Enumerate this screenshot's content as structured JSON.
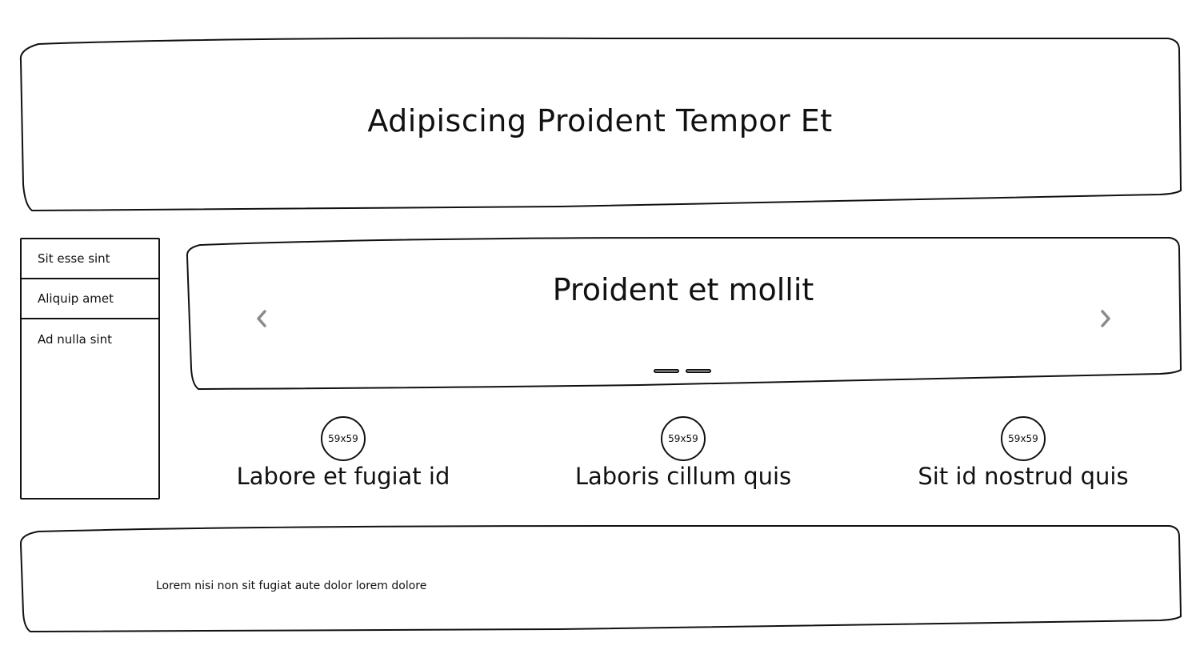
{
  "header": {
    "title": "Adipiscing Proident Tempor Et"
  },
  "sidebar": {
    "items": [
      {
        "label": "Sit esse sint"
      },
      {
        "label": "Aliquip amet"
      },
      {
        "label": "Ad nulla sint"
      }
    ]
  },
  "carousel": {
    "title": "Proident et mollit",
    "prev_icon": "chevron-left-icon",
    "next_icon": "chevron-right-icon",
    "slide_count": 2,
    "arrow_color": "#8a8a8a"
  },
  "features": [
    {
      "image_label": "59x59",
      "title": "Labore et fugiat id"
    },
    {
      "image_label": "59x59",
      "title": "Laboris cillum quis"
    },
    {
      "image_label": "59x59",
      "title": "Sit id nostrud quis"
    }
  ],
  "footer": {
    "text": "Lorem nisi non sit fugiat aute dolor lorem dolore"
  }
}
